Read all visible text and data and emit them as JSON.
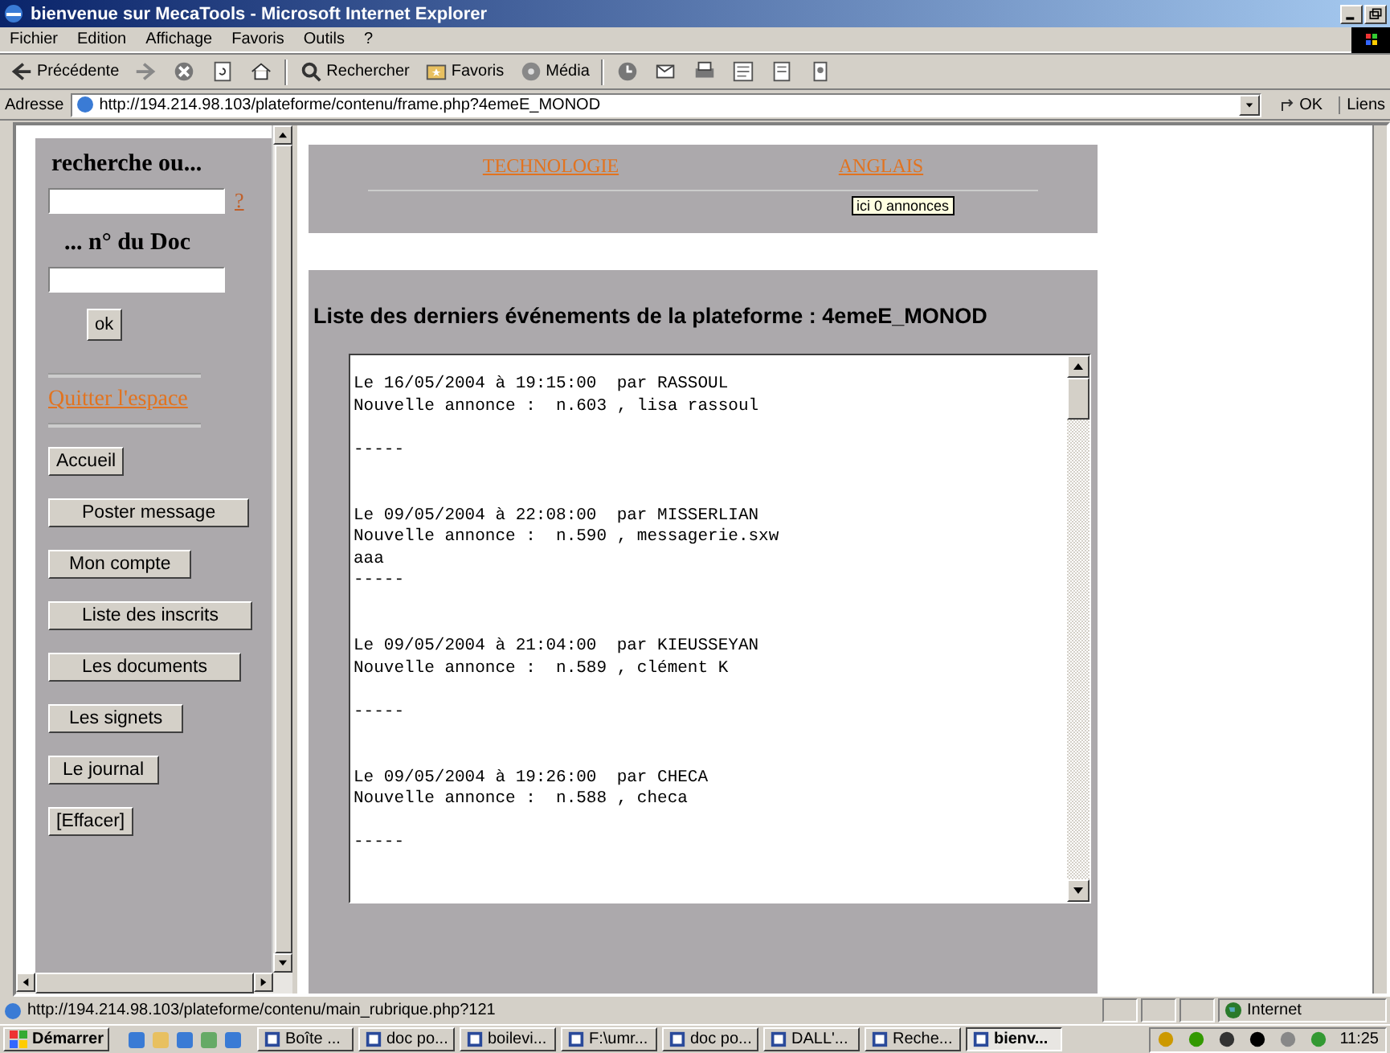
{
  "window": {
    "title": "bienvenue sur MecaTools - Microsoft Internet Explorer"
  },
  "menu": [
    "Fichier",
    "Edition",
    "Affichage",
    "Favoris",
    "Outils",
    "?"
  ],
  "toolbar": [
    {
      "kind": "back",
      "label": "Précédente"
    },
    {
      "kind": "forward"
    },
    {
      "kind": "stop"
    },
    {
      "kind": "refresh"
    },
    {
      "kind": "home"
    },
    {
      "kind": "search",
      "label": "Rechercher"
    },
    {
      "kind": "favorites",
      "label": "Favoris"
    },
    {
      "kind": "media",
      "label": "Média"
    },
    {
      "kind": "history"
    },
    {
      "kind": "mail"
    },
    {
      "kind": "print"
    },
    {
      "kind": "edit"
    },
    {
      "kind": "discuss"
    },
    {
      "kind": "messenger"
    }
  ],
  "address": {
    "label": "Adresse",
    "value": "http://194.214.98.103/plateforme/contenu/frame.php?4emeE_MONOD",
    "go": "OK",
    "links": "Liens"
  },
  "sidebar": {
    "search_label": "recherche ou...",
    "help": "?",
    "doc_label": "... n° du Doc",
    "ok": "ok",
    "quit": "Quitter l'espace",
    "buttons": [
      "Accueil",
      "Poster message",
      "Mon compte",
      "Liste des inscrits",
      "Les documents",
      "Les signets",
      "Le journal",
      "[Effacer]"
    ]
  },
  "header": {
    "links": [
      "TECHNOLOGIE",
      "ANGLAIS"
    ],
    "tooltip": "ici 0 annonces"
  },
  "events": {
    "title": "Liste des derniers événements de la plateforme : 4emeE_MONOD",
    "entries": [
      {
        "header": "Le 16/05/2004 à 19:15:00  par RASSOUL",
        "announce": "Nouvelle annonce :  n.603 , lisa rassoul",
        "separator": "-----"
      },
      {
        "header": "Le 09/05/2004 à 22:08:00  par MISSERLIAN",
        "announce": "Nouvelle annonce :  n.590 , messagerie.sxw",
        "note": "aaa",
        "separator": "-----"
      },
      {
        "header": "Le 09/05/2004 à 21:04:00  par KIEUSSEYAN",
        "announce": "Nouvelle annonce :  n.589 , clément K",
        "separator": "-----"
      },
      {
        "header": "Le 09/05/2004 à 19:26:00  par CHECA",
        "announce": "Nouvelle annonce :  n.588 , checa",
        "separator": "-----"
      }
    ]
  },
  "status_bar": {
    "url": "http://194.214.98.103/plateforme/contenu/main_rubrique.php?121",
    "zone": "Internet"
  },
  "taskbar": {
    "start": "Démarrer",
    "tasks": [
      {
        "label": "Boîte ...",
        "selected": false
      },
      {
        "label": "doc po...",
        "selected": false
      },
      {
        "label": "boilevi...",
        "selected": false
      },
      {
        "label": "F:\\umr...",
        "selected": false
      },
      {
        "label": "doc po...",
        "selected": false
      },
      {
        "label": "DALL'...",
        "selected": false
      },
      {
        "label": "Reche...",
        "selected": false
      },
      {
        "label": "bienv...",
        "selected": true
      }
    ],
    "clock": "11:25"
  }
}
